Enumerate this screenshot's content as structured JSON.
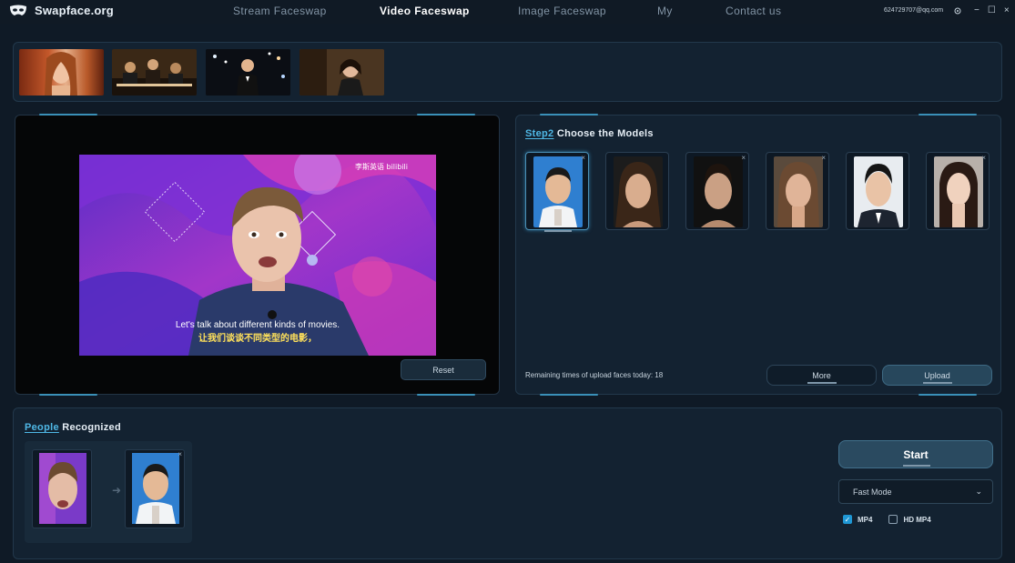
{
  "app": {
    "brand": "Swapface.org",
    "account": "624729707@qq.com"
  },
  "nav": [
    {
      "label": "Stream Faceswap",
      "active": false
    },
    {
      "label": "Video Faceswap",
      "active": true
    },
    {
      "label": "Image Faceswap",
      "active": false
    },
    {
      "label": "My",
      "active": false
    },
    {
      "label": "Contact us",
      "active": false
    }
  ],
  "window_controls": {
    "minimize": "−",
    "maximize": "☐",
    "close": "×"
  },
  "video": {
    "subtitle_en": "Let's talk about different kinds of movies.",
    "subtitle_zh": "让我们谈谈不同类型的电影，",
    "watermark": "李斯英语 bilibili",
    "reset_label": "Reset"
  },
  "models": {
    "step_prefix": "Step2",
    "title_rest": " Choose  the  Models",
    "remaining_text": "Remaining times of upload faces today: 18",
    "more_label": "More",
    "upload_label": "Upload",
    "close_glyph": "×"
  },
  "people": {
    "title_prefix": "People",
    "title_rest": " Recognized",
    "arrow_glyph": "➜"
  },
  "controls": {
    "start_label": "Start",
    "mode_value": "Fast Mode",
    "chevron": "⌄",
    "mp4_label": "MP4",
    "hd_mp4_label": "HD MP4",
    "mp4_checked": true,
    "hd_mp4_checked": false,
    "check_glyph": "✓"
  },
  "colors": {
    "accent": "#4fb8e6",
    "checkbox_on": "#1f97d4",
    "bg": "#0f1a26"
  }
}
